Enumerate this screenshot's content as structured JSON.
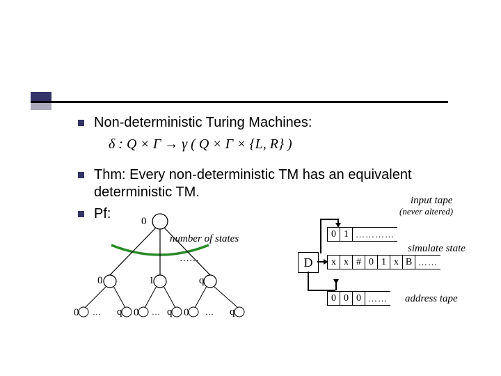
{
  "bullets": {
    "b1": "Non-deterministic Turing Machines:",
    "b2": "Thm: Every non-deterministic TM has an equivalent deterministic TM.",
    "b3": "Pf:"
  },
  "formula": "δ : Q × Γ → γ ( Q × Γ × {L, R} )",
  "tree": {
    "root": "0",
    "level1": [
      "0",
      "1",
      "q"
    ],
    "level2": [
      "0",
      "q",
      "0",
      "q",
      "0",
      "q"
    ],
    "dots_mid": "……",
    "dots_leaf": "…",
    "note": "number of states"
  },
  "tapes": {
    "d_label": "D",
    "input": {
      "cells": [
        "0",
        "1"
      ],
      "trail": "…………",
      "label": "input tape",
      "sub": "(never altered)"
    },
    "sim": {
      "cells": [
        "x",
        "x",
        "#",
        "0",
        "1",
        "x",
        "B"
      ],
      "trail": "……",
      "label": "simulate state"
    },
    "addr": {
      "cells": [
        "0",
        "0",
        "0"
      ],
      "trail": "……",
      "label": "address tape"
    }
  }
}
